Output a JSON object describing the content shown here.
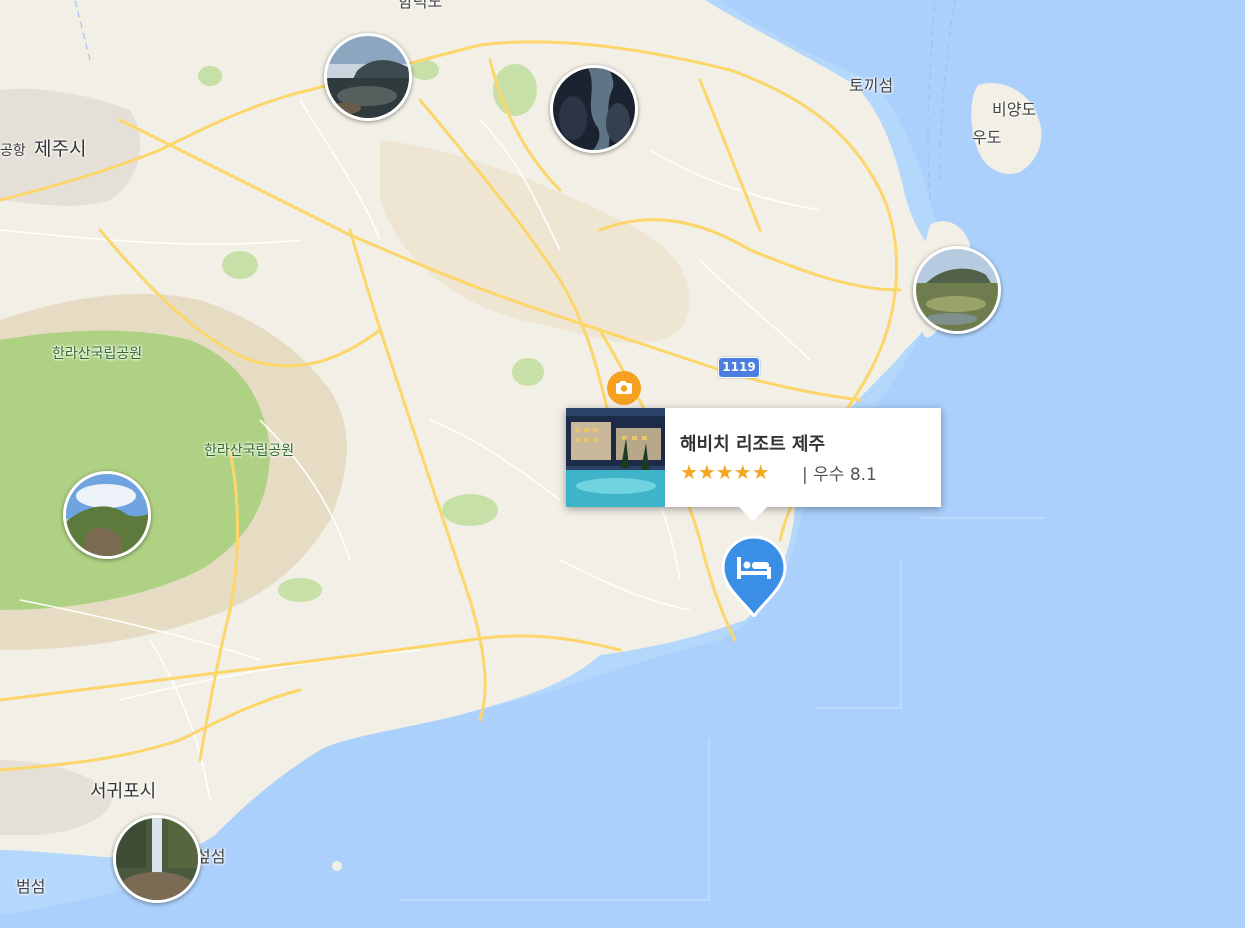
{
  "labels": {
    "jeju_city": "제주시",
    "airport_fragment": "공항",
    "hallasan_1": "한라산국립공원",
    "hallasan_2": "한라산국립공원",
    "seogwipo": "서귀포시",
    "beomseom": "범섬",
    "seom_fragment": "섶섬",
    "tokkiseom": "토끼섬",
    "biyangdo": "비양도",
    "udo": "우도",
    "top_fragment": "함덕도"
  },
  "route_badge": "1119",
  "photo_markers": [
    {
      "name": "coast-sunset"
    },
    {
      "name": "lava-cave"
    },
    {
      "name": "seongsan-ilchulbong"
    },
    {
      "name": "hallasan-peak"
    },
    {
      "name": "jeongbang-waterfall"
    }
  ],
  "hotel_card": {
    "name": "해비치 리조트 제주",
    "stars": "★★★★★",
    "rating": "| 우수 8.1"
  },
  "icons": {
    "camera": "camera-icon",
    "hotel_pin": "bed-icon"
  },
  "colors": {
    "sea": "#abd0fb",
    "land": "#f2efe6",
    "park": "#a9cf7c",
    "road": "#fcd66a",
    "accent": "#f5a020",
    "pin": "#3a8ee6"
  }
}
